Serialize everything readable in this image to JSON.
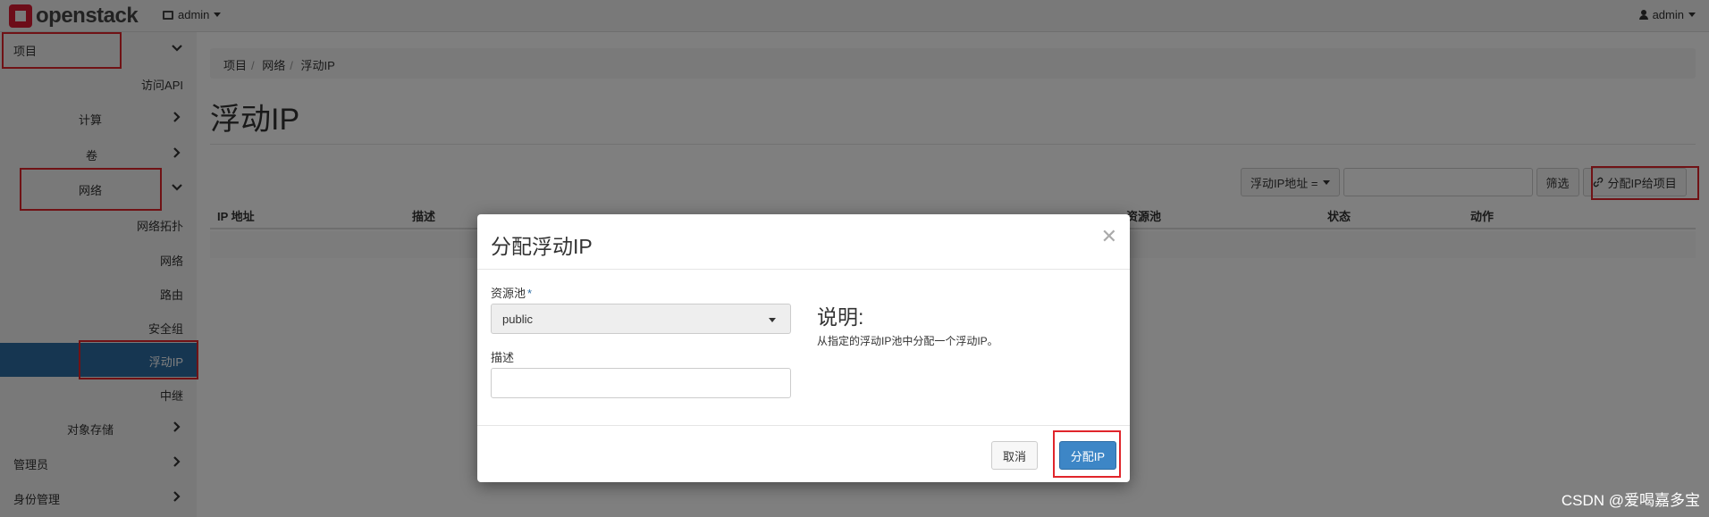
{
  "navbar": {
    "brand": "openstack",
    "project_label": "admin",
    "user_label": "admin"
  },
  "sidebar": {
    "items": [
      {
        "label": "项目",
        "chevron": "down"
      },
      {
        "label": "访问API"
      },
      {
        "label": "计算",
        "chevron": "right"
      },
      {
        "label": "卷",
        "chevron": "right"
      },
      {
        "label": "网络",
        "chevron": "down"
      },
      {
        "label": "网络拓扑"
      },
      {
        "label": "网络"
      },
      {
        "label": "路由"
      },
      {
        "label": "安全组"
      },
      {
        "label": "浮动IP",
        "active": true
      },
      {
        "label": "中继"
      },
      {
        "label": "对象存储",
        "chevron": "right"
      },
      {
        "label": "管理员",
        "chevron": "right"
      },
      {
        "label": "身份管理",
        "chevron": "right"
      }
    ]
  },
  "breadcrumb": [
    "项目",
    "网络",
    "浮动IP"
  ],
  "page_title": "浮动IP",
  "filter": {
    "field_label": "浮动IP地址 =",
    "input_value": "",
    "filter_button": "筛选",
    "allocate_button": "分配IP给项目"
  },
  "table": {
    "columns": [
      "IP 地址",
      "描述",
      "资源池",
      "状态",
      "动作"
    ]
  },
  "modal": {
    "title": "分配浮动IP",
    "pool_label": "资源池",
    "pool_required_mark": "*",
    "pool_value": "public",
    "description_label": "描述",
    "description_value": "",
    "help_title": "说明:",
    "help_text": "从指定的浮动IP池中分配一个浮动IP。",
    "cancel_button": "取消",
    "submit_button": "分配IP"
  },
  "watermark": "CSDN @爱喝嘉多宝",
  "colors": {
    "accent": "#2d6ca2",
    "primary_button": "#3d86c6",
    "highlight_box": "#e0252b",
    "brand_red": "#da1a32"
  }
}
